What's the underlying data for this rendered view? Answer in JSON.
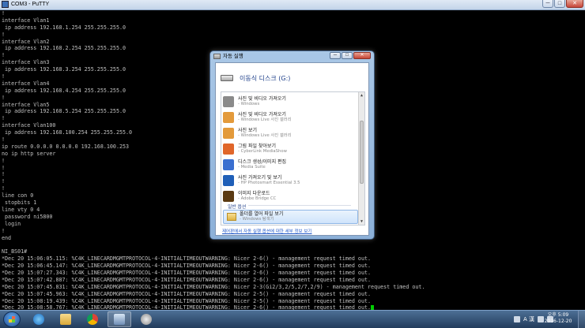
{
  "putty": {
    "title": "COM3 - PuTTY",
    "min_label": "─",
    "max_label": "□",
    "close_label": "✕"
  },
  "terminal_lines": [
    "!",
    "interface Vlan1",
    " ip address 192.168.1.254 255.255.255.0",
    "!",
    "interface Vlan2",
    " ip address 192.168.2.254 255.255.255.0",
    "!",
    "interface Vlan3",
    " ip address 192.168.3.254 255.255.255.0",
    "!",
    "interface Vlan4",
    " ip address 192.168.4.254 255.255.255.0",
    "!",
    "interface Vlan5",
    " ip address 192.168.5.254 255.255.255.0",
    "!",
    "interface Vlan100",
    " ip address 192.168.100.254 255.255.255.0",
    "!",
    "ip route 0.0.0.0 0.0.0.0 192.168.100.253",
    "no ip http server",
    "!",
    "!",
    "!",
    "!",
    "!",
    "line con 0",
    " stopbits 1",
    "line vty 0 4",
    " password ni5800",
    " login",
    "!",
    "end",
    "",
    "NI_BS01#",
    "*Dec 20 15:06:05.115: %C4K_LINECARDMGMTPROTOCOL-4-INITIALTIMEOUTWARNING: Nicer 2-6() - management request timed out.",
    "*Dec 20 15:06:45.147: %C4K_LINECARDMGMTPROTOCOL-4-INITIALTIMEOUTWARNING: Nicer 2-6() - management request timed out.",
    "*Dec 20 15:07:27.343: %C4K_LINECARDMGMTPROTOCOL-4-INITIALTIMEOUTWARNING: Nicer 2-6() - management request timed out.",
    "*Dec 20 15:07:42.887: %C4K_LINECARDMGMTPROTOCOL-4-INITIALTIMEOUTWARNING: Nicer 2-6() - management request timed out.",
    "*Dec 20 15:07:45.831: %C4K_LINECARDMGMTPROTOCOL-4-INITIALTIMEOUTWARNING: Nicer 2-3(Gi2/3,2/5,2/7,2/9) - management request timed out.",
    "*Dec 20 15:07:45.963: %C4K_LINECARDMGMTPROTOCOL-4-INITIALTIMEOUTWARNING: Nicer 2-5() - management request timed out.",
    "*Dec 20 15:08:19.439: %C4K_LINECARDMGMTPROTOCOL-4-INITIALTIMEOUTWARNING: Nicer 2-5() - management request timed out.",
    "*Dec 20 15:08:58.767: %C4K_LINECARDMGMTPROTOCOL-4-INITIALTIMEOUTWARNING: Nicer 2-6() - management request timed out."
  ],
  "autoplay": {
    "title": "자동 실행",
    "min_label": "─",
    "max_label": "□",
    "close_label": "✕",
    "drive_name": "이동식 디스크 (G:)",
    "items": [
      {
        "label": "사진 및 비디오 가져오기",
        "sub": "- Windows",
        "icon": "camera-icon",
        "color": "#8a8a8a"
      },
      {
        "label": "사진 및 비디오 가져오기",
        "sub": "- Windows Live 사진 갤러리",
        "icon": "photo-gallery-icon",
        "color": "#e39a3b"
      },
      {
        "label": "사진 보기",
        "sub": "- Windows Live 사진 갤러리",
        "icon": "photo-gallery-icon",
        "color": "#e39a3b"
      },
      {
        "label": "그림 파일 찾아보기",
        "sub": "- CyberLink MediaShow",
        "icon": "mediashow-icon",
        "color": "#e0662a"
      },
      {
        "label": "디스크 생성/이미지 편집",
        "sub": "- Media Suite",
        "icon": "media-suite-icon",
        "color": "#3a6fd0"
      },
      {
        "label": "사진 가져오기 및 보기",
        "sub": "- HP Photosmart Essential 3.5",
        "icon": "hp-icon",
        "color": "#1f5fb8"
      },
      {
        "label": "이미지 다운로드",
        "sub": "- Adobe Bridge CC",
        "icon": "adobe-bridge-icon",
        "color": "#5a3a12"
      }
    ],
    "section_label": "일반 옵션",
    "folder_label": "폴더를 열어 파일 보기",
    "folder_sub": "- Windows 탐색기",
    "footer_link": "제어판에서 자동 실행 옵션에 대한 세부 정보 보기"
  },
  "taskbar": {
    "tray_lang": "A 漢",
    "clock_time": "오후 5:09",
    "clock_date": "2016-12-20"
  }
}
